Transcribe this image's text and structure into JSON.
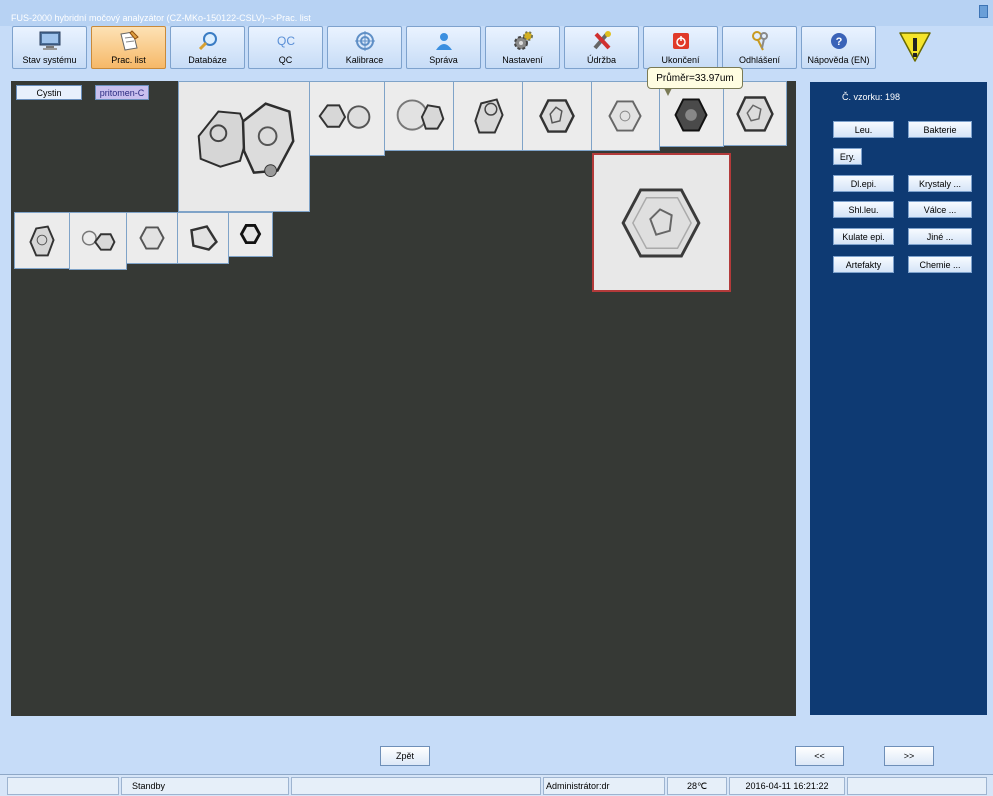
{
  "window": {
    "title": "FUS-2000 hybridní močový analyzátor (CZ-MKo-150122-CSLV)-->Prac. list"
  },
  "toolbar": [
    {
      "label": "Stav systému",
      "icon": "monitor-icon",
      "active": false
    },
    {
      "label": "Prac. list",
      "icon": "worksheet-icon",
      "active": true
    },
    {
      "label": "Databáze",
      "icon": "magnifier-icon",
      "active": false
    },
    {
      "label": "QC",
      "icon": "qc-icon",
      "active": false
    },
    {
      "label": "Kalibrace",
      "icon": "target-icon",
      "active": false
    },
    {
      "label": "Správa",
      "icon": "user-icon",
      "active": false
    },
    {
      "label": "Nastavení",
      "icon": "gears-icon",
      "active": false
    },
    {
      "label": "Údržba",
      "icon": "tools-icon",
      "active": false
    },
    {
      "label": "Ukončení",
      "icon": "power-icon",
      "active": false
    },
    {
      "label": "Odhlášení",
      "icon": "keys-icon",
      "active": false
    },
    {
      "label": "Nápověda (EN)",
      "icon": "help-icon",
      "active": false
    }
  ],
  "tooltip": {
    "text": "Průměr=33.97um"
  },
  "worksheet": {
    "tabs": [
      {
        "label": "Cystin"
      },
      {
        "label": "pritomen-C"
      }
    ]
  },
  "right_panel": {
    "sample_label": "Č. vzorku: 198",
    "buttons": [
      {
        "label": "Leu."
      },
      {
        "label": "Bakterie"
      },
      {
        "label": "Ery."
      },
      {
        "label": "Dl.epi."
      },
      {
        "label": "Krystaly ..."
      },
      {
        "label": "Shl.leu."
      },
      {
        "label": "Válce ..."
      },
      {
        "label": "Kulate epi."
      },
      {
        "label": "Jiné ..."
      },
      {
        "label": "Artefakty"
      },
      {
        "label": "Chemie ..."
      }
    ]
  },
  "navigation": {
    "back": "Zpět",
    "prev": "<<",
    "next": ">>"
  },
  "status_bar": {
    "state": "Standby",
    "user": "Administrátor:dr",
    "temperature": "28℃",
    "datetime": "2016-04-11 16:21:22"
  },
  "colors": {
    "workarea": "#363935",
    "panel": "#0e3a73",
    "active_tab": "#f6b868",
    "selected_border": "#b33a3a",
    "warning": "#f5e42a"
  }
}
